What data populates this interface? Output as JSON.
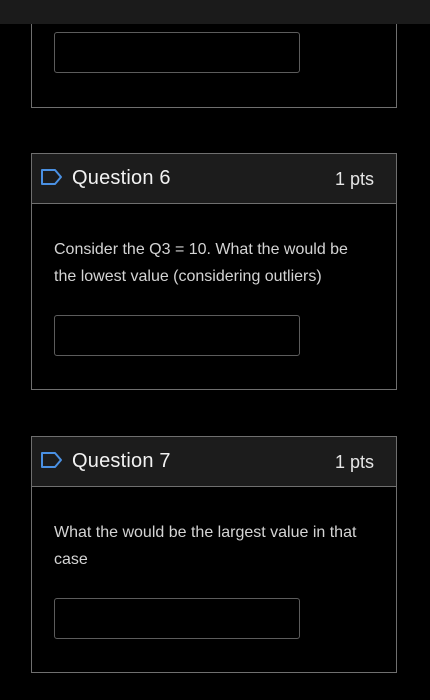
{
  "questions": [
    {
      "title": "",
      "points": "",
      "text": "",
      "answer_value": ""
    },
    {
      "title": "Question 6",
      "points": "1 pts",
      "text": "Consider the Q3 = 10. What the would be the lowest value (considering outliers)",
      "answer_value": ""
    },
    {
      "title": "Question 7",
      "points": "1 pts",
      "text": "What the would be the largest value in that case",
      "answer_value": ""
    }
  ],
  "colors": {
    "accent": "#4a90e2",
    "background": "#000000",
    "header": "#1c1c1c",
    "border": "#6f6f6f"
  },
  "icons": {
    "question_flag": "flag-icon"
  }
}
